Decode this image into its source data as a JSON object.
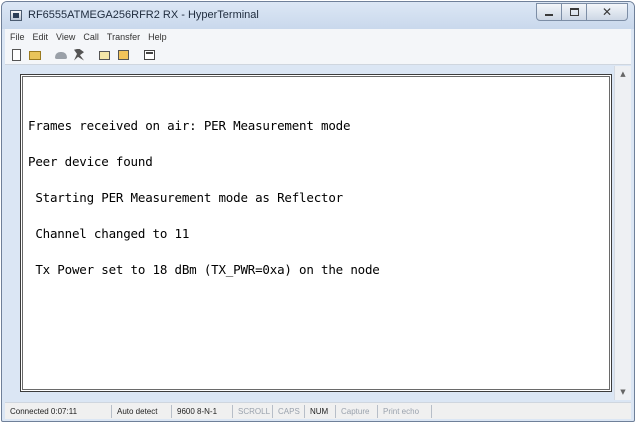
{
  "window": {
    "title": "RF6555ATMEGA256RFR2 RX - HyperTerminal",
    "controls": {
      "minimize_icon": "minimize-icon",
      "maximize_icon": "maximize-icon",
      "close_icon": "close-icon",
      "close_glyph": "✕"
    }
  },
  "menu": {
    "items": [
      "File",
      "Edit",
      "View",
      "Call",
      "Transfer",
      "Help"
    ]
  },
  "toolbar": {
    "icons": [
      "new-icon",
      "open-icon",
      "call-icon",
      "disconnect-icon",
      "send-icon",
      "receive-icon",
      "properties-icon"
    ]
  },
  "terminal": {
    "lines": [
      "Frames received on air: PER Measurement mode",
      "Peer device found",
      " Starting PER Measurement mode as Reflector",
      " Channel changed to 11",
      " Tx Power set to 18 dBm (TX_PWR=0xa) on the node"
    ]
  },
  "scrollbar": {
    "up_glyph": "▲",
    "down_glyph": "▼"
  },
  "status": {
    "connected": "Connected 0:07:11",
    "detect": "Auto detect",
    "settings": "9600 8-N-1",
    "scroll": "SCROLL",
    "caps": "CAPS",
    "num": "NUM",
    "capture": "Capture",
    "print_echo": "Print echo"
  },
  "colors": {
    "window_frame": "#dbe6f4",
    "terminal_bg": "#ffffff",
    "terminal_text": "#000000",
    "disabled_status": "#9aa2ad"
  }
}
